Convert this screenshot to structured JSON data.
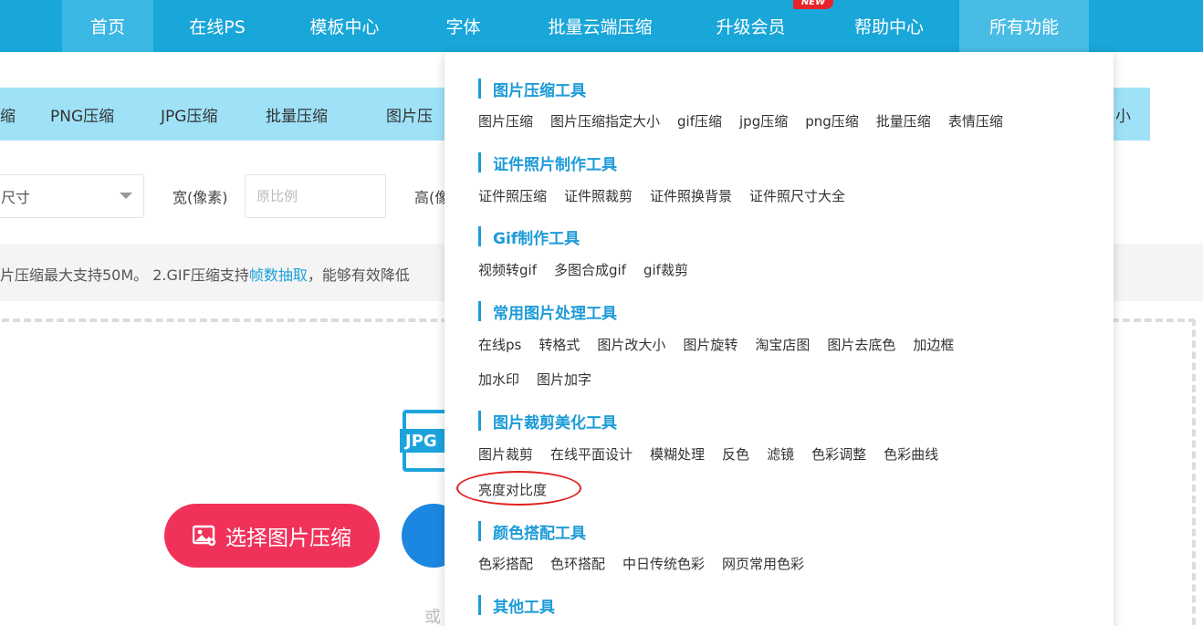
{
  "nav": {
    "items": [
      "首页",
      "在线PS",
      "模板中心",
      "字体",
      "批量云端压缩",
      "升级会员",
      "帮助中心",
      "所有功能"
    ],
    "new_badge": "NEW"
  },
  "subnav": {
    "items": [
      "缩",
      "PNG压缩",
      "JPG压缩",
      "批量压缩",
      "图片压",
      "小"
    ]
  },
  "settings": {
    "size_select": "尺寸",
    "width_label": "宽(像素)",
    "width_placeholder": "原比例",
    "height_label": "高(像"
  },
  "notice": {
    "prefix": "片压缩最大支持50M。 2.GIF压缩支持",
    "link": "帧数抽取",
    "suffix": "，能够有效降低"
  },
  "upload": {
    "jpg_icon": "JPG",
    "select_button": "选择图片压缩",
    "or_text": "或"
  },
  "dropdown": {
    "sections": [
      {
        "title": "图片压缩工具",
        "rows": [
          [
            "图片压缩",
            "图片压缩指定大小",
            "gif压缩",
            "jpg压缩",
            "png压缩",
            "批量压缩",
            "表情压缩"
          ]
        ]
      },
      {
        "title": "证件照片制作工具",
        "rows": [
          [
            "证件照压缩",
            "证件照裁剪",
            "证件照换背景",
            "证件照尺寸大全"
          ]
        ]
      },
      {
        "title": "Gif制作工具",
        "rows": [
          [
            "视频转gif",
            "多图合成gif",
            "gif裁剪"
          ]
        ]
      },
      {
        "title": "常用图片处理工具",
        "rows": [
          [
            "在线ps",
            "转格式",
            "图片改大小",
            "图片旋转",
            "淘宝店图",
            "图片去底色",
            "加边框"
          ],
          [
            "加水印",
            "图片加字"
          ]
        ]
      },
      {
        "title": "图片裁剪美化工具",
        "rows": [
          [
            "图片裁剪",
            "在线平面设计",
            "模糊处理",
            "反色",
            "滤镜",
            "色彩调整",
            "色彩曲线"
          ],
          [
            "亮度对比度"
          ]
        ]
      },
      {
        "title": "颜色搭配工具",
        "rows": [
          [
            "色彩搭配",
            "色环搭配",
            "中日传统色彩",
            "网页常用色彩"
          ]
        ]
      },
      {
        "title": "其他工具",
        "rows": []
      }
    ]
  },
  "colors": {
    "nav_bg": "#19a6d8",
    "accent": "#1d9bd8",
    "primary_button": "#f0325a",
    "zip_button": "#1c87e0",
    "highlight": "#e02020"
  }
}
